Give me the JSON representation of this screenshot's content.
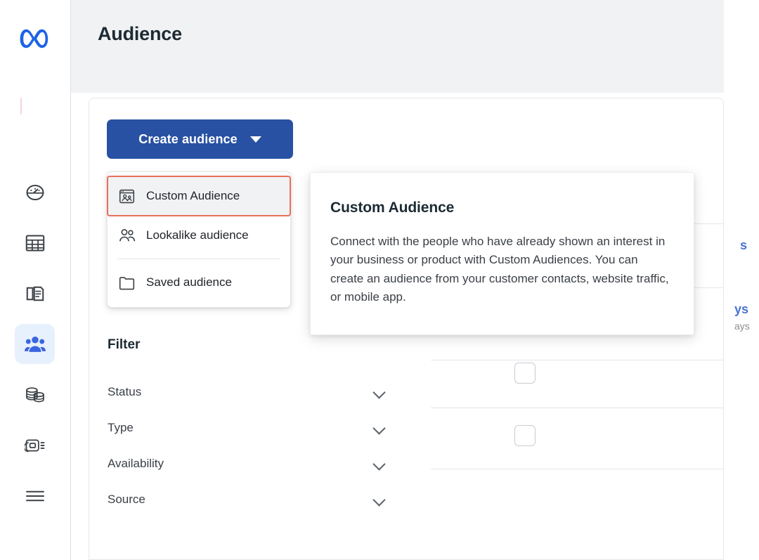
{
  "brand": {
    "logo": "meta-infinity-logo",
    "logo_color": "#1d63e6"
  },
  "sidebar": {
    "items": [
      {
        "name": "dashboard",
        "icon": "gauge-icon",
        "active": false
      },
      {
        "name": "table",
        "icon": "table-grid-icon",
        "active": false
      },
      {
        "name": "ads",
        "icon": "cards-stack-icon",
        "active": false
      },
      {
        "name": "audiences",
        "icon": "people-group-icon",
        "active": true
      },
      {
        "name": "billing",
        "icon": "coins-stack-icon",
        "active": false
      },
      {
        "name": "assets",
        "icon": "media-collection-icon",
        "active": false
      },
      {
        "name": "more",
        "icon": "hamburger-menu-icon",
        "active": false
      }
    ],
    "active_background": "#e7f0fd",
    "active_icon_color": "#3a65e0"
  },
  "header": {
    "title": "Audience"
  },
  "toolbar": {
    "create_button": {
      "label": "Create audience",
      "icon": "chevron-down-icon",
      "background": "#2851a3",
      "text_color": "#ffffff"
    }
  },
  "create_menu": {
    "items": [
      {
        "label": "Custom Audience",
        "icon": "custom-audience-icon",
        "highlighted": true
      },
      {
        "label": "Lookalike audience",
        "icon": "lookalike-people-icon",
        "highlighted": false
      },
      {
        "label": "Saved audience",
        "icon": "folder-icon",
        "highlighted": false
      }
    ],
    "highlight_border_color": "#e8705a",
    "highlight_background": "#f1f2f3"
  },
  "tooltip": {
    "title": "Custom Audience",
    "body": "Connect with the people who have already shown an interest in your business or product with Custom Audiences. You can create an audience from your customer contacts, website traffic, or mobile app."
  },
  "filter": {
    "title": "Filter",
    "rows": [
      {
        "label": "Status",
        "icon": "chevron-down-icon"
      },
      {
        "label": "Type",
        "icon": "chevron-down-icon"
      },
      {
        "label": "Availability",
        "icon": "chevron-down-icon"
      },
      {
        "label": "Source",
        "icon": "chevron-down-icon"
      }
    ]
  },
  "audience_list": {
    "rows": [
      {
        "checkbox_checked": false,
        "link_text": "s",
        "sub_text": ""
      },
      {
        "checkbox_checked": false,
        "link_text": "ys",
        "sub_text": "ays"
      }
    ]
  }
}
